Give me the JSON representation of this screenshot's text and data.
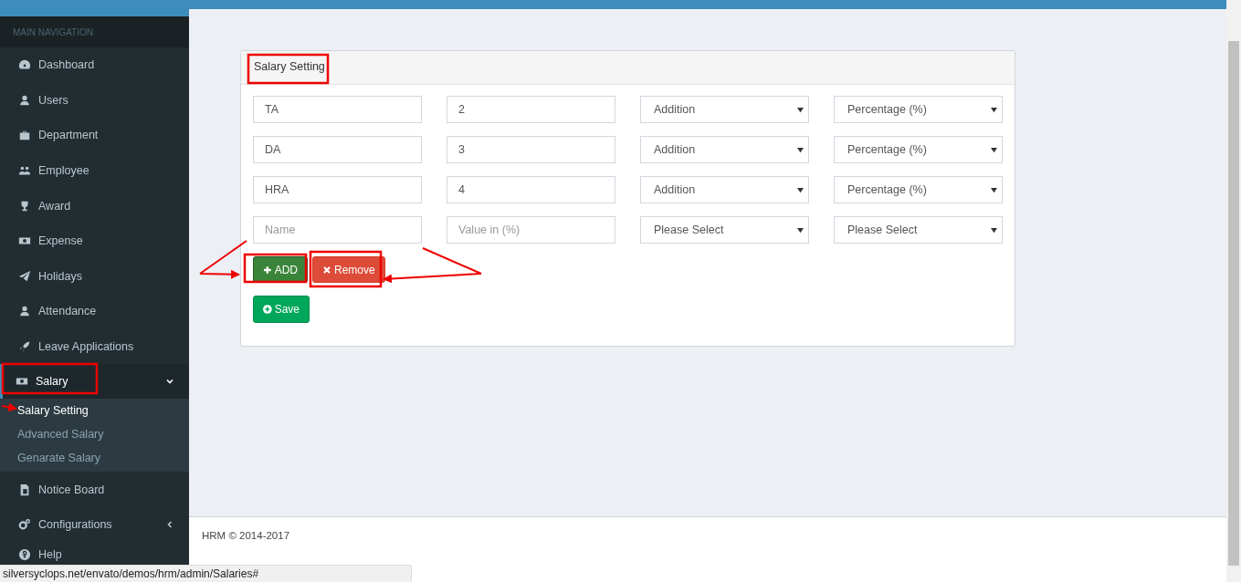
{
  "sidebar": {
    "header": "MAIN NAVIGATION",
    "items": [
      {
        "label": "Dashboard"
      },
      {
        "label": "Users"
      },
      {
        "label": "Department"
      },
      {
        "label": "Employee"
      },
      {
        "label": "Award"
      },
      {
        "label": "Expense"
      },
      {
        "label": "Holidays"
      },
      {
        "label": "Attendance"
      },
      {
        "label": "Leave Applications"
      },
      {
        "label": "Salary",
        "expanded": true,
        "children": [
          {
            "label": "Salary Setting",
            "selected": true
          },
          {
            "label": "Advanced Salary",
            "selected": false
          },
          {
            "label": "Genarate Salary",
            "selected": false
          }
        ]
      },
      {
        "label": "Notice Board"
      },
      {
        "label": "Configurations",
        "expanded": false
      },
      {
        "label": "Help"
      }
    ]
  },
  "card": {
    "title": "Salary Setting",
    "rows": [
      {
        "name": "TA",
        "value": "2",
        "type": "Addition",
        "unit": "Percentage (%)"
      },
      {
        "name": "DA",
        "value": "3",
        "type": "Addition",
        "unit": "Percentage (%)"
      },
      {
        "name": "HRA",
        "value": "4",
        "type": "Addition",
        "unit": "Percentage (%)"
      }
    ],
    "new_row": {
      "name": {
        "placeholder": "Name"
      },
      "value": {
        "placeholder": "Value in (%)"
      },
      "type": "Please Select",
      "unit": "Please Select"
    },
    "buttons": [
      {
        "kind": "add",
        "label": "ADD"
      },
      {
        "kind": "remove",
        "label": "Remove"
      }
    ],
    "save": "Save"
  },
  "footer": "HRM © 2014-2017",
  "status_bar": "silversyclops.net/envato/demos/hrm/admin/Salaries#"
}
